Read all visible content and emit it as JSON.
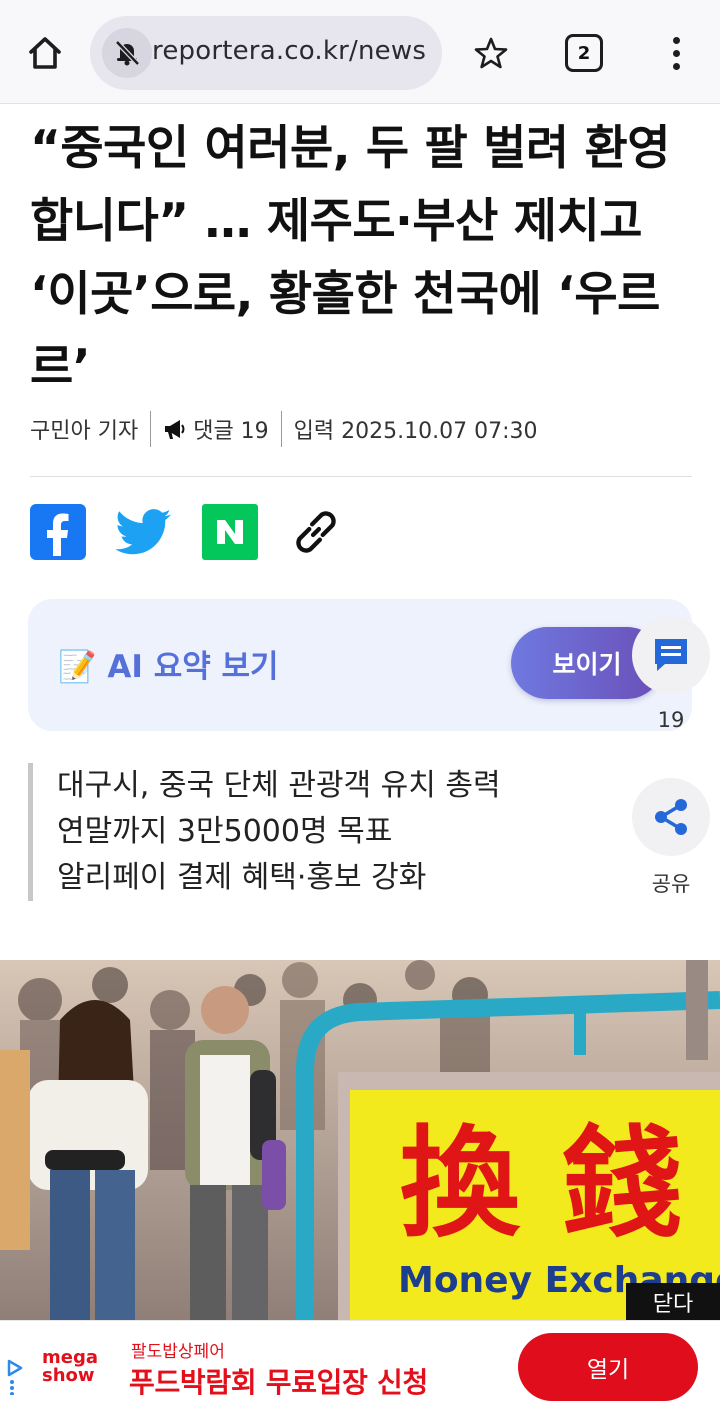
{
  "browser": {
    "url": "reportera.co.kr/news",
    "tab_count": "2"
  },
  "article": {
    "headline": "“중국인 여러분, 두 팔 벌려 환영합니다” … 제주도·부산 제치고 ‘이곳’으로, 황홀한 천국에 ‘우르르’",
    "author": "구민아 기자",
    "comment_label": "댓글 19",
    "published": "입력 2025.10.07 07:30",
    "summary_lines": [
      "대구시, 중국 단체 관광객 유치 총력",
      "연말까지 3만5000명 목표",
      "알리페이 결제 혜택·홍보 강화"
    ]
  },
  "ai_summary": {
    "label": "📝 AI 요약 보기",
    "button": "보이기"
  },
  "floating": {
    "comment_count": "19",
    "share_label": "공유"
  },
  "photo": {
    "sign_chars": "換 錢",
    "sign_english": "Money Exchange"
  },
  "ad": {
    "close_label": "닫다",
    "logo_text_top": "mega",
    "logo_text_bottom": "show",
    "brand": "팔도밥상페어",
    "headline": "푸드박람회 무료입장 신청",
    "button": "열기"
  },
  "colors": {
    "accent_blue": "#5570d8",
    "ai_button_start": "#6f79e0",
    "ai_button_end": "#6a4fb7",
    "facebook": "#1877f2",
    "twitter": "#1da1f2",
    "naver": "#03c75a",
    "ad_red": "#e00d1c"
  }
}
